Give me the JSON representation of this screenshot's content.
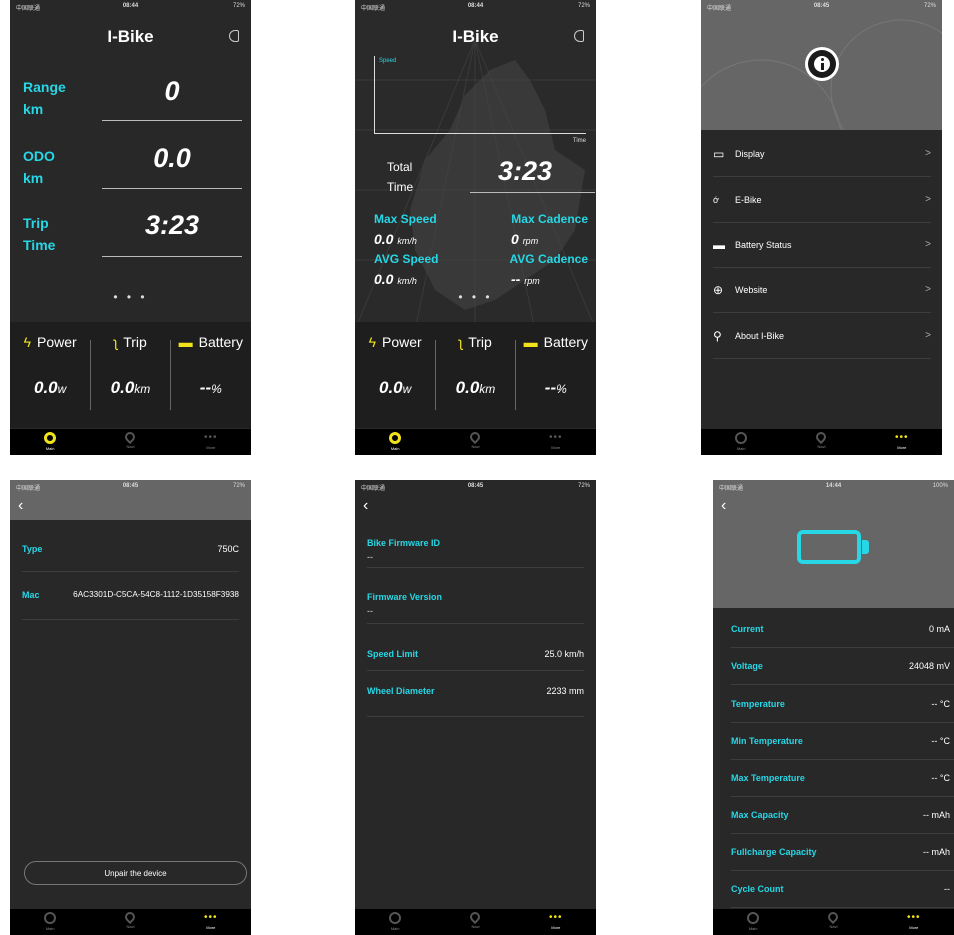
{
  "status_bar": {
    "carrier": "中国联通",
    "time1": "08:44",
    "time2": "08:44",
    "time3": "08:45",
    "time4": "08:45",
    "time5": "08:45",
    "time6": "14:44",
    "batt": "72%",
    "batt6": "100%"
  },
  "tabs": {
    "main": "Main",
    "navi": "Navi",
    "more": "More"
  },
  "screen1": {
    "title": "I-Bike",
    "range_label_1": "Range",
    "range_label_2": "km",
    "range_value": "0",
    "odo_label_1": "ODO",
    "odo_label_2": "km",
    "odo_value": "0.0",
    "trip_label_1": "Trip",
    "trip_label_2": "Time",
    "trip_value": "3:23",
    "pager": "• • •",
    "power_label": "Power",
    "trip_label": "Trip",
    "battery_label": "Battery",
    "power_value": "0.0",
    "power_unit": "w",
    "trip_value_km": "0.0",
    "trip_unit": "km",
    "battery_value": "--",
    "battery_unit": "%"
  },
  "screen2": {
    "title": "I-Bike",
    "chart_speed_label": "Speed",
    "chart_time_label": "Time",
    "total_label_1": "Total",
    "total_label_2": "Time",
    "total_value": "3:23",
    "max_speed_label": "Max Speed",
    "max_speed_value": "0.0",
    "max_speed_unit": "km/h",
    "max_cadence_label": "Max Cadence",
    "max_cadence_value": "0",
    "max_cadence_unit": "rpm",
    "avg_speed_label": "AVG Speed",
    "avg_speed_value": "0.0",
    "avg_speed_unit": "km/h",
    "avg_cadence_label": "AVG Cadence",
    "avg_cadence_value": "--",
    "avg_cadence_unit": "rpm",
    "pager": "• • •",
    "power_label": "Power",
    "trip_label": "Trip",
    "battery_label": "Battery",
    "power_value": "0.0",
    "power_unit": "w",
    "trip_value_km": "0.0",
    "trip_unit": "km",
    "battery_value": "--",
    "battery_unit": "%"
  },
  "screen3": {
    "menu": {
      "display": "Display",
      "ebike": "E-Bike",
      "battery": "Battery Status",
      "website": "Website",
      "about": "About I-Bike"
    },
    "chevron": ">"
  },
  "screen4": {
    "type_label": "Type",
    "type_value": "750C",
    "mac_label": "Mac",
    "mac_value": "6AC3301D-C5CA-54C8-1112-1D35158F3938",
    "unpair": "Unpair the device"
  },
  "screen5": {
    "fw_id_label": "Bike Firmware ID",
    "fw_id_value": "--",
    "fw_ver_label": "Firmware Version",
    "fw_ver_value": "--",
    "speed_limit_label": "Speed Limit",
    "speed_limit_value": "25.0 km/h",
    "wheel_label": "Wheel Diameter",
    "wheel_value": "2233 mm"
  },
  "screen6": {
    "rows": [
      {
        "k": "Current",
        "v": "0 mA"
      },
      {
        "k": "Voltage",
        "v": "24048 mV"
      },
      {
        "k": "Temperature",
        "v": "-- °C"
      },
      {
        "k": "Min Temperature",
        "v": "-- °C"
      },
      {
        "k": "Max Temperature",
        "v": "-- °C"
      },
      {
        "k": "Max Capacity",
        "v": "-- mAh"
      },
      {
        "k": "Fullcharge Capacity",
        "v": "-- mAh"
      },
      {
        "k": "Cycle Count",
        "v": "--"
      }
    ]
  },
  "colors": {
    "accent_cyan": "#27d7e6",
    "accent_yellow": "#f1e21b",
    "bg": "#282828"
  }
}
